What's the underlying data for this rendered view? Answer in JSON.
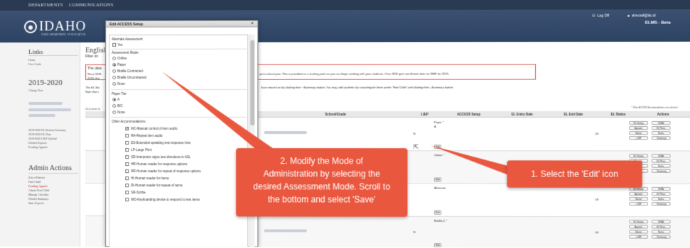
{
  "topnav": {
    "departments": "DEPARTMENTS",
    "communications": "COMMUNICATIONS"
  },
  "header": {
    "logo_text": "IDAHO",
    "logo_sub": "STATE DEPARTMENT OF EDUCATION",
    "logoff_label": "Log Off",
    "user": "ahmcraft@idu.id",
    "app_name": "ELMS - Beta"
  },
  "sidebar": {
    "links_heading": "Links",
    "home": "Home",
    "user_guide": "User Guide",
    "year": "2019-2020",
    "change_year": "Change Year",
    "items": [
      "2019-2020 EL Student Summary",
      "2019-2020 EL Data",
      "2019-2020 LIEP Upload",
      "District Reports",
      "Pending Appeals"
    ],
    "admin_heading": "Admin Actions",
    "admin_items": [
      "Select District",
      "Find Child",
      "Pending Appeals",
      "Admin Find Child",
      "Manage Calendar",
      "District Summary",
      "State Reports"
    ]
  },
  "main": {
    "title": "English",
    "filter_label": "Filter on",
    "notice_heading": "The data",
    "notice_line1a": "Since SDE",
    "notice_line1b": "prior school year. This is provided as a starting point so you can begin working with your students. Once SDE gets enrollment data via ISEE for 2019-",
    "notice_line2": "2020, this",
    "info_line1a": "The EL Stu",
    "info_line1b": "have moved on by clicking their ~Summary button. You may add students by searching for them under \"Find Child\" and clicking their +Summary button.",
    "info_line2": "Note that s",
    "shown_label": "Click column he",
    "note": "* Other ACCESS Accommodations are selected"
  },
  "table": {
    "headers": [
      "El",
      "School/Grade",
      "LIEP",
      "ACCESS Setup",
      "EL Entry Date",
      "EL Exit Date",
      "EL Status",
      "Actions"
    ],
    "rows": [
      {
        "dob": "",
        "liep": "N",
        "access": "Paper *",
        "access_tier": "A",
        "status": "LE"
      },
      {
        "dob": "",
        "liep": "",
        "access": "Online *",
        "access_tier": "",
        "status": "LE"
      },
      {
        "dob": "",
        "liep": "",
        "access": "Alternate",
        "access_tier": "",
        "status": "LE"
      },
      {
        "dob": "6/27/2002",
        "liep": "N",
        "access": "Braille-C *",
        "access_tier": "",
        "status": "LE"
      }
    ],
    "edit_label": "Edit",
    "action_labels": [
      "EL History",
      "MIEA",
      "Appeals",
      "EL Plans",
      "Waiver",
      "Notes",
      "+ IMP",
      "~Summary"
    ]
  },
  "modal": {
    "title": "Edit ACCESS Setup",
    "close_label": "×",
    "alternate_heading": "Alternate Assessment",
    "alternate_yes": "Yes",
    "mode_heading": "Assessment Mode:",
    "modes": [
      "Online",
      "Paper",
      "Braille Contracted",
      "Braille Uncontracted",
      "None"
    ],
    "mode_selected": "Paper",
    "tier_heading": "Paper Tier",
    "tiers": [
      "A",
      "B/C",
      "None"
    ],
    "tier_selected": "A",
    "accom_heading": "Other Accommodations:",
    "accommodations": [
      {
        "label": "MC-Manual control of item audio",
        "checked": true
      },
      {
        "label": "RA-Repeat item audio",
        "checked": false
      },
      {
        "label": "ES-Extended speaking test response time",
        "checked": false
      },
      {
        "label": "LP-Large Print",
        "checked": false
      },
      {
        "label": "SD-Interpreter signs test directions in ASL",
        "checked": false
      },
      {
        "label": "HR-Human reader for response options",
        "checked": false
      },
      {
        "label": "RR-Human reader for repeat of response options",
        "checked": false
      },
      {
        "label": "HI-Human reader for items",
        "checked": false
      },
      {
        "label": "RI-Human reader for repeat of items",
        "checked": false
      },
      {
        "label": "SR-Scribe",
        "checked": false
      },
      {
        "label": "WD-Keyboarding device to respond to test items",
        "checked": false
      }
    ]
  },
  "callouts": {
    "step1": "1. Select the 'Edit' icon",
    "step2": [
      "2. Modify the Mode of",
      "Administration by selecting the",
      "desired Assessment Mode. Scroll to",
      "the bottom and select 'Save'"
    ]
  },
  "colors": {
    "callout": "#e9573f",
    "header": "#2d4363",
    "notice_border": "#d9534f"
  },
  "icons": {
    "close": "close-icon",
    "logoff": "power-icon",
    "user": "user-icon",
    "cursor": "mouse-cursor-icon"
  }
}
